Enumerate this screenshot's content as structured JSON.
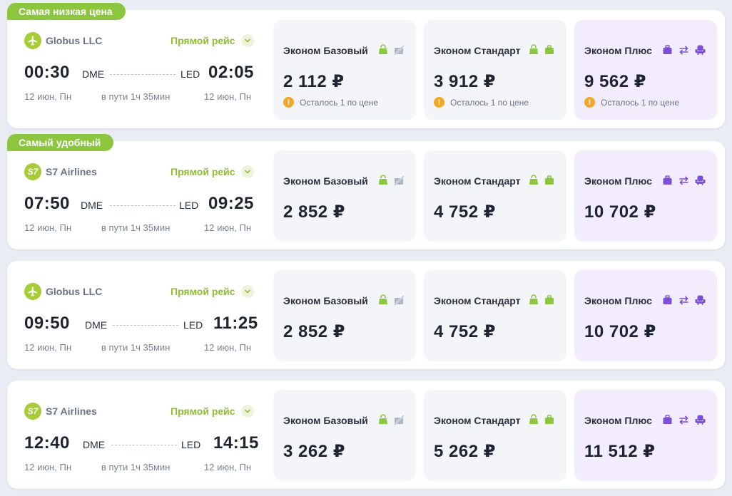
{
  "badges": {
    "cheapest": "Самая низкая цена",
    "comfortable": "Самый удобный"
  },
  "colors": {
    "accent_green": "#8cc63f",
    "plus_purple": "#7b4fd6",
    "warning_orange": "#f5a623"
  },
  "flights": [
    {
      "airline": "Globus LLC",
      "logo_icon": "airplane-icon",
      "direct_label": "Прямой рейс",
      "dep_time": "00:30",
      "dep_code": "DME",
      "arr_code": "LED",
      "arr_time": "02:05",
      "dep_date": "12 июн, Пн",
      "duration": "в пути 1ч 35мин",
      "arr_date": "12 июн, Пн",
      "fares": [
        {
          "name": "Эконом Базовый",
          "price": "2 112 ₽",
          "warning": "Осталось 1 по цене"
        },
        {
          "name": "Эконом Стандарт",
          "price": "3 912 ₽",
          "warning": "Осталось 1 по цене"
        },
        {
          "name": "Эконом Плюс",
          "price": "9 562 ₽",
          "warning": "Осталось 1 по цене"
        }
      ]
    },
    {
      "airline": "S7 Airlines",
      "logo_icon": "s7-logo-icon",
      "direct_label": "Прямой рейс",
      "dep_time": "07:50",
      "dep_code": "DME",
      "arr_code": "LED",
      "arr_time": "09:25",
      "dep_date": "12 июн, Пн",
      "duration": "в пути 1ч 35мин",
      "arr_date": "12 июн, Пн",
      "fares": [
        {
          "name": "Эконом Базовый",
          "price": "2 852 ₽"
        },
        {
          "name": "Эконом Стандарт",
          "price": "4 752 ₽"
        },
        {
          "name": "Эконом Плюс",
          "price": "10 702 ₽"
        }
      ]
    },
    {
      "airline": "Globus LLC",
      "logo_icon": "airplane-icon",
      "direct_label": "Прямой рейс",
      "dep_time": "09:50",
      "dep_code": "DME",
      "arr_code": "LED",
      "arr_time": "11:25",
      "dep_date": "12 июн, Пн",
      "duration": "в пути 1ч 35мин",
      "arr_date": "12 июн, Пн",
      "fares": [
        {
          "name": "Эконом Базовый",
          "price": "2 852 ₽"
        },
        {
          "name": "Эконом Стандарт",
          "price": "4 752 ₽"
        },
        {
          "name": "Эконом Плюс",
          "price": "10 702 ₽"
        }
      ]
    },
    {
      "airline": "S7 Airlines",
      "logo_icon": "s7-logo-icon",
      "direct_label": "Прямой рейс",
      "dep_time": "12:40",
      "dep_code": "DME",
      "arr_code": "LED",
      "arr_time": "14:15",
      "dep_date": "12 июн, Пн",
      "duration": "в пути 1ч 35мин",
      "arr_date": "12 июн, Пн",
      "fares": [
        {
          "name": "Эконом Базовый",
          "price": "3 262 ₽"
        },
        {
          "name": "Эконом Стандарт",
          "price": "5 262 ₽"
        },
        {
          "name": "Эконом Плюс",
          "price": "11 512 ₽"
        }
      ]
    }
  ]
}
